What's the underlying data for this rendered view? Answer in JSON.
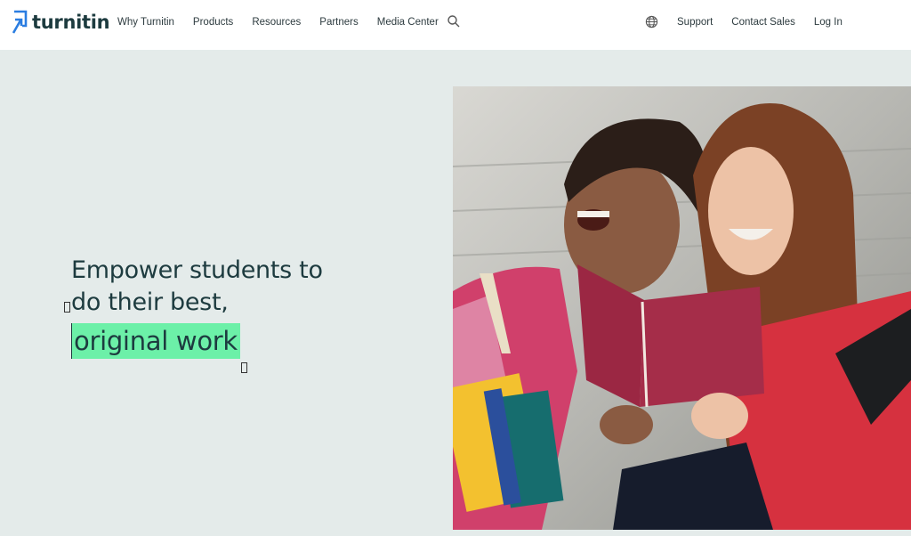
{
  "brand": {
    "name": "turnitin",
    "color": "#1d3b3f",
    "accent": "#2a7de1"
  },
  "nav": {
    "items": [
      "Why Turnitin",
      "Products",
      "Resources",
      "Partners",
      "Media Center"
    ],
    "search_icon": "search-icon"
  },
  "right_nav": {
    "globe_icon": "globe-icon",
    "items": [
      "Support",
      "Contact Sales",
      "Log In"
    ]
  },
  "hero": {
    "line1": "Empower students to",
    "line2": "do their best,",
    "highlight": "original work",
    "highlight_color": "#6cf0a8",
    "background": "#e4ebea"
  },
  "photo": {
    "icon": "students-laughing-with-books-photo"
  }
}
